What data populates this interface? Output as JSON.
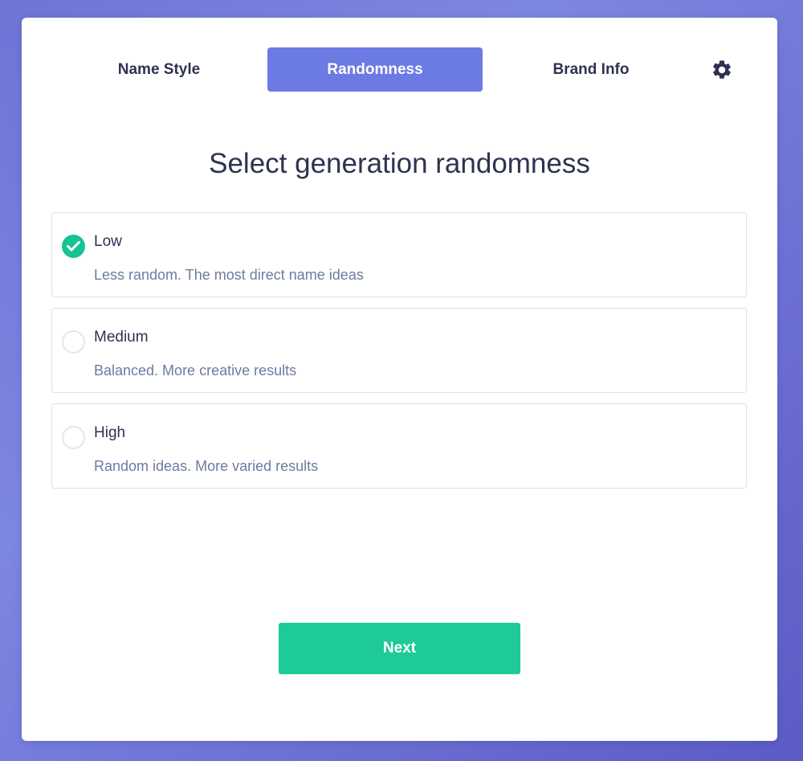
{
  "tabs": [
    {
      "label": "Name Style",
      "active": false
    },
    {
      "label": "Randomness",
      "active": true
    },
    {
      "label": "Brand Info",
      "active": false
    }
  ],
  "settings_icon": "gear-icon",
  "title": "Select generation randomness",
  "options": [
    {
      "label": "Low",
      "description": "Less random. The most direct name ideas",
      "selected": true
    },
    {
      "label": "Medium",
      "description": "Balanced. More creative results",
      "selected": false
    },
    {
      "label": "High",
      "description": "Random ideas. More varied results",
      "selected": false
    }
  ],
  "next_label": "Next",
  "colors": {
    "accent": "#6c7ae4",
    "success": "#1ecb98",
    "text": "#2f3350",
    "muted": "#6f7aa0"
  }
}
